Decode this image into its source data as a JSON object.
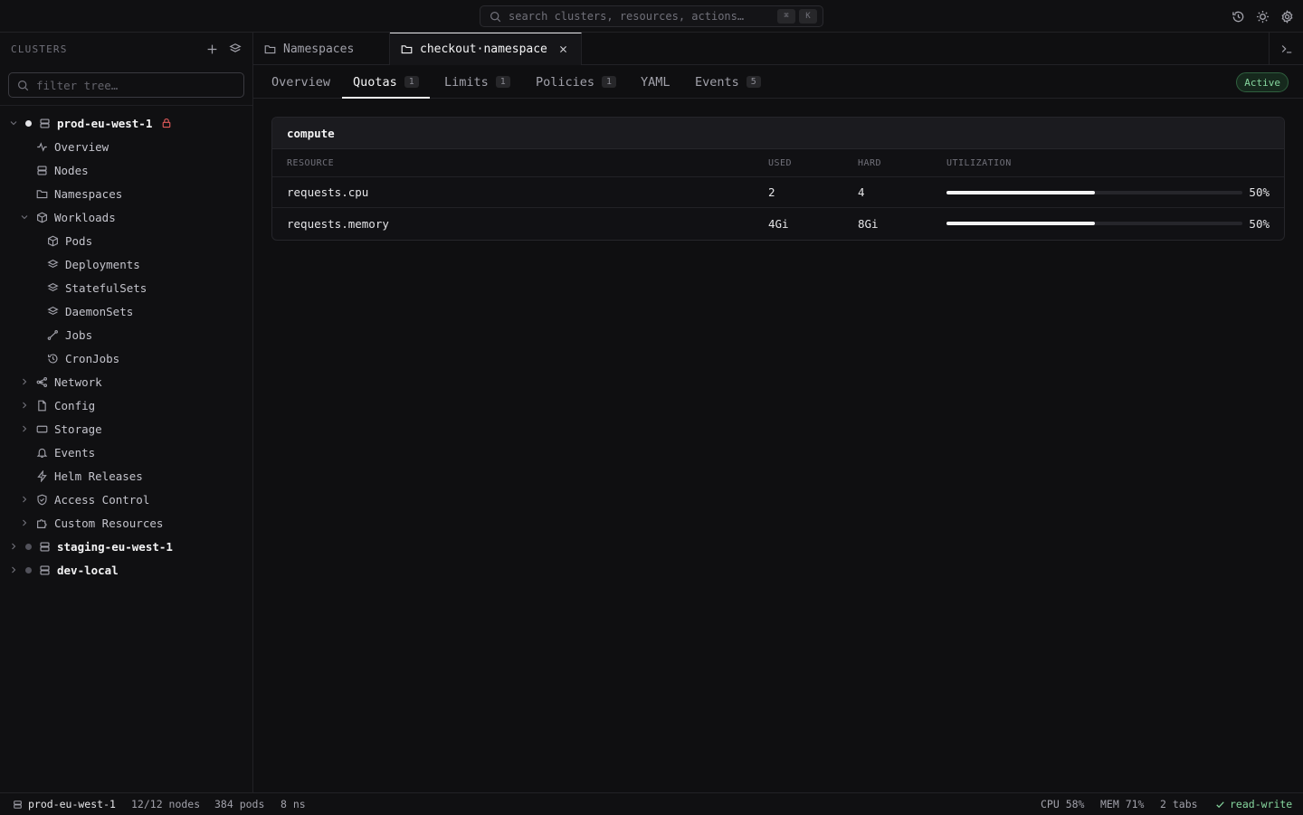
{
  "search": {
    "placeholder": "search clusters, resources, actions…",
    "kbd_mod": "⌘",
    "kbd_key": "K"
  },
  "sidebar": {
    "heading": "CLUSTERS",
    "filter_placeholder": "filter tree…",
    "clusters": [
      {
        "name": "prod-eu-west-1",
        "expanded": true,
        "status_color": "#e4e4e7",
        "locked": true
      },
      {
        "name": "staging-eu-west-1",
        "expanded": false,
        "status_color": "#52525b"
      },
      {
        "name": "dev-local",
        "expanded": false,
        "status_color": "#52525b"
      }
    ],
    "items": {
      "overview": "Overview",
      "nodes": "Nodes",
      "namespaces": "Namespaces",
      "workloads": "Workloads",
      "pods": "Pods",
      "deployments": "Deployments",
      "statefulsets": "StatefulSets",
      "daemonsets": "DaemonSets",
      "jobs": "Jobs",
      "cronjobs": "CronJobs",
      "network": "Network",
      "config": "Config",
      "storage": "Storage",
      "events": "Events",
      "helm": "Helm Releases",
      "access": "Access Control",
      "custom": "Custom Resources"
    }
  },
  "tabs": [
    {
      "label": "Namespaces",
      "active": false
    },
    {
      "label": "checkout·namespace",
      "active": true
    }
  ],
  "subtabs": [
    {
      "label": "Overview",
      "count": null
    },
    {
      "label": "Quotas",
      "count": "1",
      "active": true
    },
    {
      "label": "Limits",
      "count": "1"
    },
    {
      "label": "Policies",
      "count": "1"
    },
    {
      "label": "YAML",
      "count": null
    },
    {
      "label": "Events",
      "count": "5"
    }
  ],
  "status_badge": "Active",
  "quota": {
    "name": "compute",
    "columns": [
      "RESOURCE",
      "USED",
      "HARD",
      "UTILIZATION"
    ],
    "rows": [
      {
        "resource": "requests.cpu",
        "used": "2",
        "hard": "4",
        "utilization_pct": 50,
        "utilization_label": "50%"
      },
      {
        "resource": "requests.memory",
        "used": "4Gi",
        "hard": "8Gi",
        "utilization_pct": 50,
        "utilization_label": "50%"
      }
    ]
  },
  "statusbar": {
    "cluster": "prod-eu-west-1",
    "nodes": "12/12 nodes",
    "pods": "384 pods",
    "ns": "8 ns",
    "cpu": "CPU 58%",
    "mem": "MEM 71%",
    "tabs": "2 tabs",
    "mode": "read-write"
  },
  "colors": {
    "accent": "#f4f4f5",
    "ok": "#86d69e",
    "lock": "#e05a5a"
  }
}
